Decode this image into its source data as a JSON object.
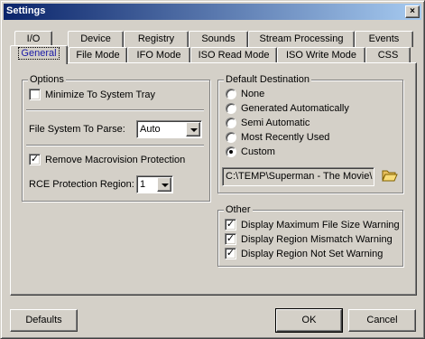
{
  "window": {
    "title": "Settings",
    "close_glyph": "×"
  },
  "tabs": {
    "row1": [
      "I/O",
      "Device",
      "Registry",
      "Sounds",
      "Stream Processing",
      "Events"
    ],
    "row2": [
      "General",
      "File Mode",
      "IFO Mode",
      "ISO Read Mode",
      "ISO Write Mode",
      "CSS"
    ],
    "active": "General"
  },
  "options": {
    "group_label": "Options",
    "minimize_label": "Minimize To System Tray",
    "minimize_checked": false,
    "fs_label": "File System To Parse:",
    "fs_value": "Auto",
    "macrovision_label": "Remove Macrovision Protection",
    "macrovision_checked": true,
    "rce_label": "RCE Protection Region:",
    "rce_value": "1"
  },
  "destination": {
    "group_label": "Default Destination",
    "choices": [
      "None",
      "Generated Automatically",
      "Semi Automatic",
      "Most Recently Used",
      "Custom"
    ],
    "selected": "Custom",
    "path": "C:\\TEMP\\Superman - The Movie\\",
    "folder_icon": "open-folder-icon"
  },
  "other": {
    "group_label": "Other",
    "items": [
      {
        "label": "Display Maximum File Size Warning",
        "checked": true
      },
      {
        "label": "Display Region Mismatch Warning",
        "checked": true
      },
      {
        "label": "Display Region Not Set Warning",
        "checked": true
      }
    ]
  },
  "buttons": {
    "defaults": "Defaults",
    "ok": "OK",
    "cancel": "Cancel"
  },
  "check_glyph": "✓"
}
